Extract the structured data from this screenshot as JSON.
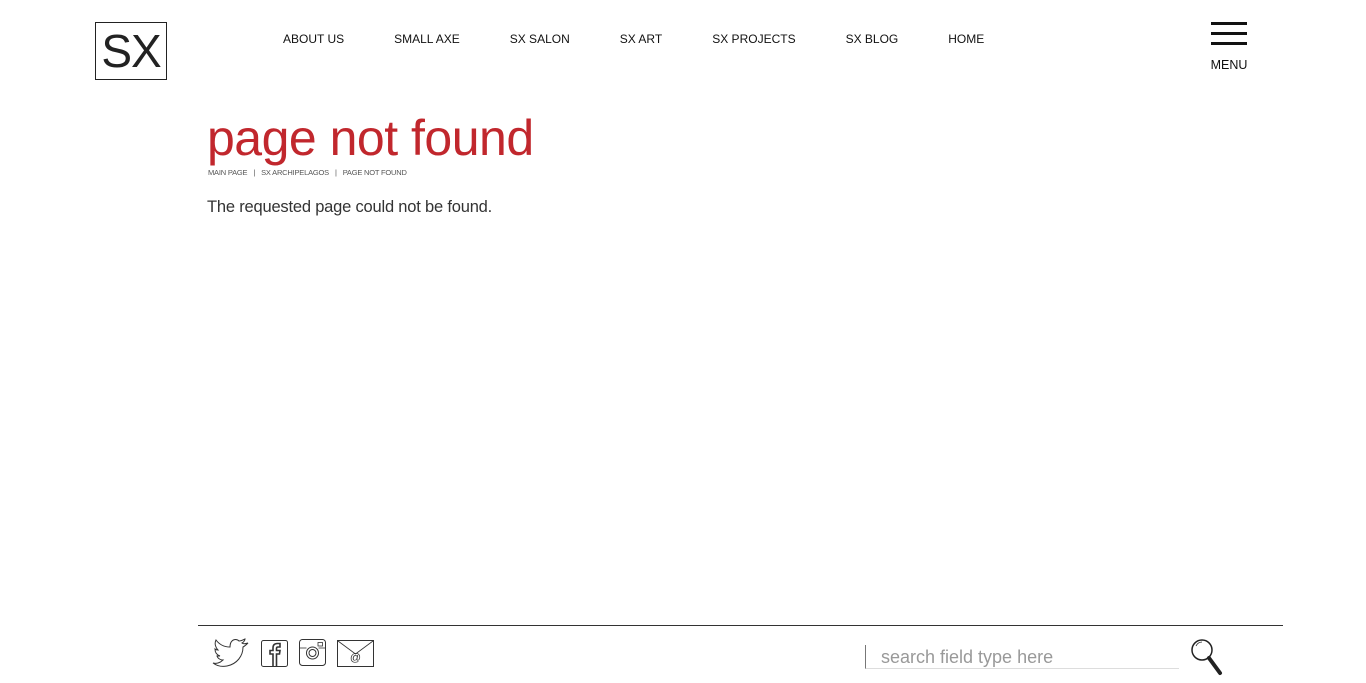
{
  "logo": {
    "text": "SX"
  },
  "nav": {
    "items": [
      {
        "label": "ABOUT US"
      },
      {
        "label": "SMALL AXE"
      },
      {
        "label": "SX SALON"
      },
      {
        "label": "SX ART"
      },
      {
        "label": "SX PROJECTS"
      },
      {
        "label": "SX BLOG"
      },
      {
        "label": "HOME"
      }
    ]
  },
  "menu": {
    "label": "MENU",
    "icon": "hamburger-icon"
  },
  "content": {
    "title": "page not found",
    "breadcrumb": [
      "MAIN PAGE",
      "SX ARCHIPELAGOS",
      "PAGE NOT FOUND"
    ],
    "breadcrumb_separator": "|",
    "message": "The requested page could not be found."
  },
  "footer": {
    "social": [
      {
        "name": "twitter-icon"
      },
      {
        "name": "facebook-icon"
      },
      {
        "name": "instagram-icon"
      },
      {
        "name": "email-icon"
      }
    ],
    "search": {
      "placeholder": "search field type here",
      "value": "",
      "icon": "search-icon"
    }
  },
  "colors": {
    "accent": "#c1272d",
    "text": "#222222",
    "background": "#ffffff"
  }
}
